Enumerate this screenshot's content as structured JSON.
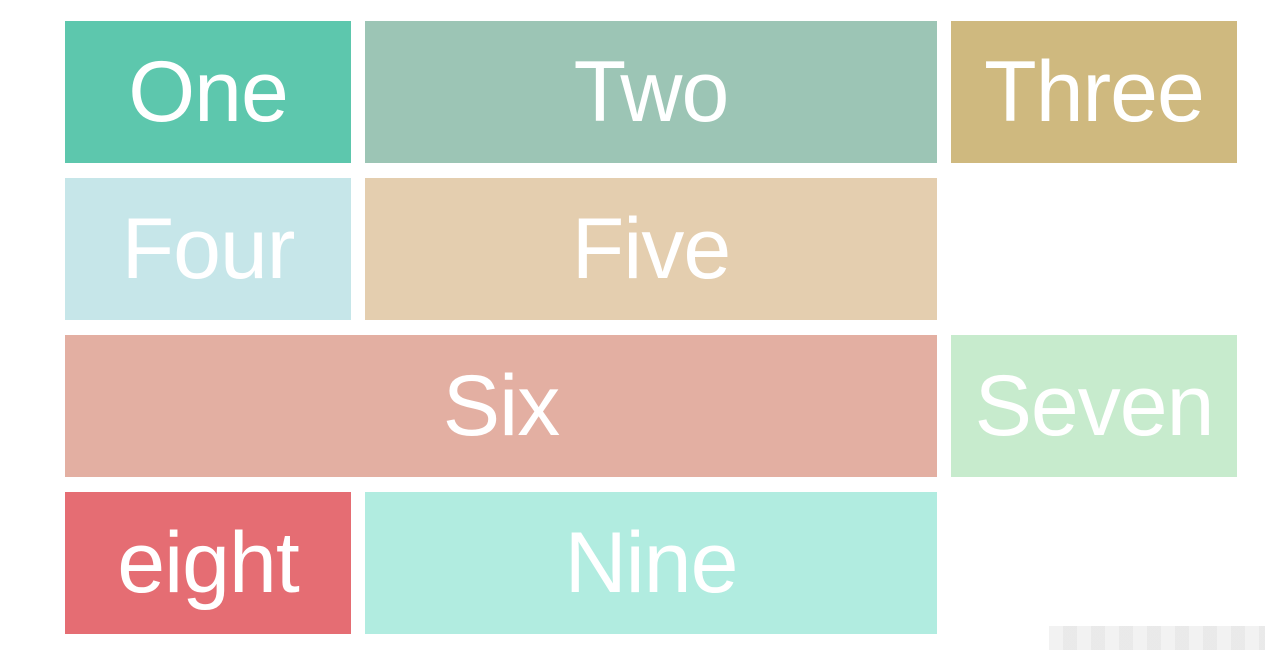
{
  "cells": [
    {
      "label": "One",
      "color": "#5dc7ad"
    },
    {
      "label": "Two",
      "color": "#9cc5b5"
    },
    {
      "label": "Three",
      "color": "#cfb97f"
    },
    {
      "label": "Four",
      "color": "#c6e6e9"
    },
    {
      "label": "Five",
      "color": "#e4ceaf"
    },
    {
      "label": "Six",
      "color": "#e3afa2"
    },
    {
      "label": "Seven",
      "color": "#c7ebcd"
    },
    {
      "label": "eight",
      "color": "#e56d73"
    },
    {
      "label": "Nine",
      "color": "#b1ece0"
    }
  ]
}
